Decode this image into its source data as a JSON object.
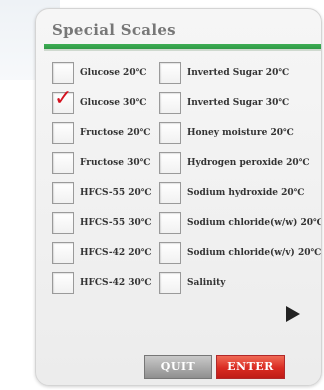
{
  "panel": {
    "title": "Special Scales"
  },
  "scales_left": [
    {
      "label": "Glucose 20℃",
      "checked": false
    },
    {
      "label": "Glucose 30℃",
      "checked": true
    },
    {
      "label": "Fructose 20℃",
      "checked": false
    },
    {
      "label": "Fructose 30℃",
      "checked": false
    },
    {
      "label": "HFCS-55 20℃",
      "checked": false
    },
    {
      "label": "HFCS-55 30℃",
      "checked": false
    },
    {
      "label": "HFCS-42 20℃",
      "checked": false
    },
    {
      "label": "HFCS-42 30℃",
      "checked": false
    }
  ],
  "scales_right": [
    {
      "label": "Inverted Sugar 20℃",
      "checked": false
    },
    {
      "label": "Inverted Sugar 30℃",
      "checked": false
    },
    {
      "label": "Honey moisture 20℃",
      "checked": false
    },
    {
      "label": "Hydrogen peroxide 20℃",
      "checked": false
    },
    {
      "label": "Sodium hydroxide 20℃",
      "checked": false
    },
    {
      "label": "Sodium chloride(w/w) 20℃",
      "checked": false
    },
    {
      "label": "Sodium chloride(w/v) 20℃",
      "checked": false
    },
    {
      "label": "Salinity",
      "checked": false
    }
  ],
  "check_mark": "✓",
  "buttons": {
    "quit_label": "QUIT",
    "enter_label": "ENTER"
  },
  "colors": {
    "accent_green": "#3fae55",
    "enter_red": "#d92b22",
    "check_red": "#d4121f"
  }
}
